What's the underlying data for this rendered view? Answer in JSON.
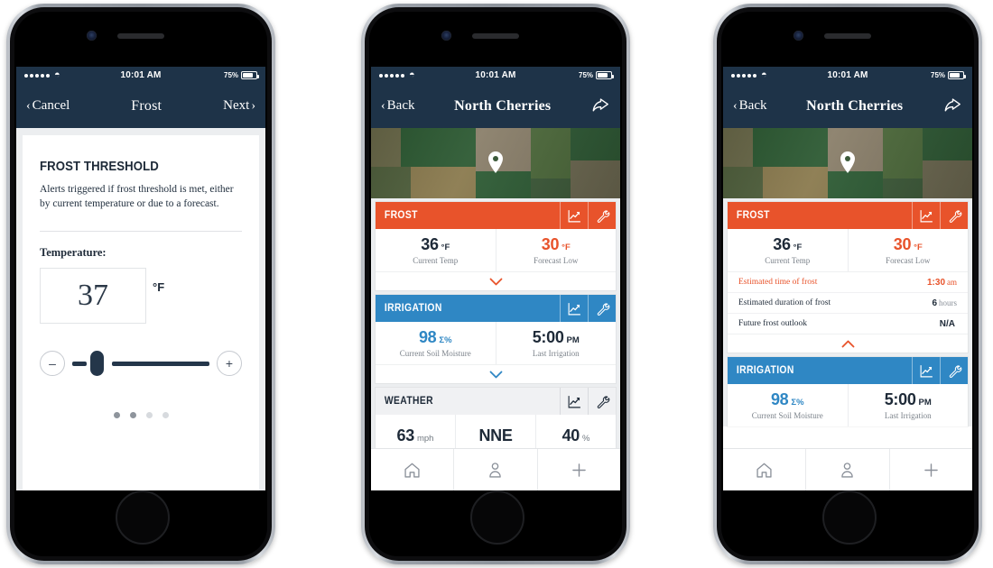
{
  "status_bar": {
    "signal_dots": 5,
    "wifi_icon": "wifi-icon",
    "time": "10:01 AM",
    "battery_percent": "75%"
  },
  "colors": {
    "navy": "#1e3348",
    "frost_orange": "#e8532b",
    "irrigation_blue": "#2f87c4",
    "text_dark": "#1e2a38",
    "muted": "#7c838b"
  },
  "phone1": {
    "nav": {
      "left_label": "Cancel",
      "title": "Frost",
      "right_label": "Next"
    },
    "heading": "FROST THRESHOLD",
    "description": "Alerts triggered if frost threshold is met, either by current temperature or due to a forecast.",
    "temperature_label": "Temperature:",
    "temperature_value": "37",
    "temperature_unit": "°F",
    "slider": {
      "decrement_label": "–",
      "increment_label": "+",
      "position_percent": 14
    },
    "pager": {
      "total": 4,
      "active_count": 2
    }
  },
  "phone2": {
    "nav": {
      "left_label": "Back",
      "title": "North Cherries",
      "right_icon": "share-icon"
    },
    "map": {
      "pin_icon": "map-pin-icon"
    },
    "cards": [
      {
        "title": "FROST",
        "theme": "frost",
        "chart_icon": "line-chart-icon",
        "settings_icon": "wrench-icon",
        "stats": [
          {
            "number": "36",
            "suffix": "°F",
            "suffix_style": "dark",
            "label": "Current Temp"
          },
          {
            "number": "30",
            "suffix": "°F",
            "suffix_style": "orange",
            "number_style": "orange",
            "label": "Forecast Low"
          }
        ],
        "expander_icon": "chevron-down-icon",
        "expanded": false
      },
      {
        "title": "IRRIGATION",
        "theme": "irr",
        "chart_icon": "line-chart-icon",
        "settings_icon": "wrench-icon",
        "stats": [
          {
            "number": "98",
            "suffix": "Σ%",
            "suffix_style": "blue",
            "number_style": "blue",
            "label": "Current Soil Moisture"
          },
          {
            "number": "5:00",
            "suffix": "PM",
            "suffix_style": "dark",
            "label": "Last Irrigation"
          }
        ],
        "expander_icon": "chevron-down-icon",
        "expanded": false
      },
      {
        "title": "WEATHER",
        "theme": "wx",
        "chart_icon": "line-chart-icon",
        "settings_icon": "wrench-icon",
        "stats": [
          {
            "number": "63",
            "suffix": "mph",
            "suffix_style": "gray",
            "label": ""
          },
          {
            "number": "NNE",
            "suffix": "",
            "suffix_style": "gray",
            "label": ""
          },
          {
            "number": "40",
            "suffix": "%",
            "suffix_style": "gray",
            "label": ""
          }
        ],
        "clipped": true
      }
    ],
    "tabs": [
      {
        "icon": "home-icon",
        "name": "home"
      },
      {
        "icon": "person-icon",
        "name": "account"
      },
      {
        "icon": "plus-icon",
        "name": "add"
      }
    ]
  },
  "phone3": {
    "nav": {
      "left_label": "Back",
      "title": "North Cherries",
      "right_icon": "share-icon"
    },
    "map": {
      "pin_icon": "map-pin-icon"
    },
    "frost_card": {
      "title": "FROST",
      "chart_icon": "line-chart-icon",
      "settings_icon": "wrench-icon",
      "stats": [
        {
          "number": "36",
          "suffix": "°F",
          "suffix_style": "dark",
          "label": "Current Temp"
        },
        {
          "number": "30",
          "suffix": "°F",
          "suffix_style": "orange",
          "number_style": "orange",
          "label": "Forecast Low"
        }
      ],
      "details": [
        {
          "key": "Estimated time of frost",
          "value": "1:30",
          "unit": "am",
          "highlight": true
        },
        {
          "key": "Estimated duration of frost",
          "value": "6",
          "unit": "hours",
          "highlight": false
        },
        {
          "key": "Future frost outlook",
          "value": "N/A",
          "unit": "",
          "highlight": false
        }
      ],
      "collapse_icon": "chevron-up-icon",
      "expanded": true
    },
    "irrigation_card": {
      "title": "IRRIGATION",
      "chart_icon": "line-chart-icon",
      "settings_icon": "wrench-icon",
      "stats": [
        {
          "number": "98",
          "suffix": "Σ%",
          "suffix_style": "blue",
          "number_style": "blue",
          "label": "Current Soil Moisture"
        },
        {
          "number": "5:00",
          "suffix": "PM",
          "suffix_style": "dark",
          "label": "Last Irrigation"
        }
      ]
    },
    "tabs": [
      {
        "icon": "home-icon",
        "name": "home"
      },
      {
        "icon": "person-icon",
        "name": "account"
      },
      {
        "icon": "plus-icon",
        "name": "add"
      }
    ]
  }
}
